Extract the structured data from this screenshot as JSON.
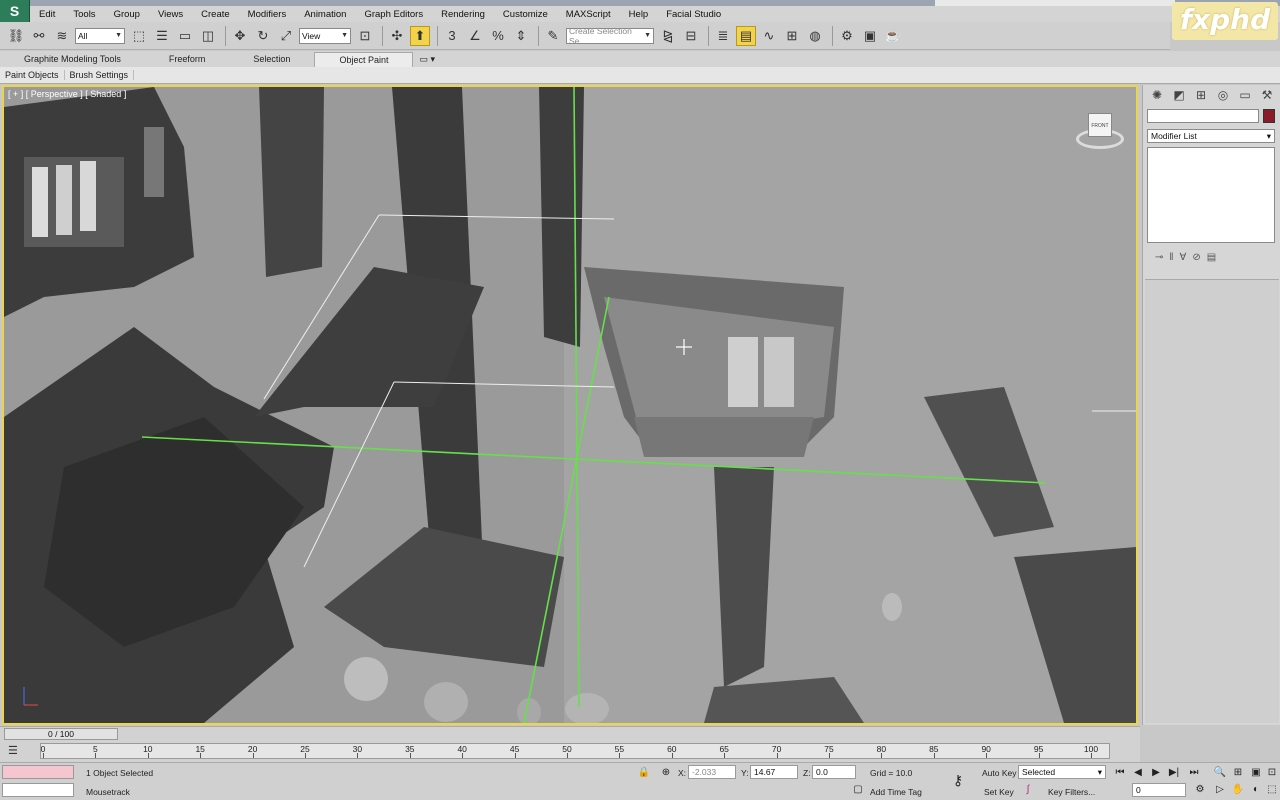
{
  "app": {
    "logo_text": "fxphd"
  },
  "menu": [
    "Edit",
    "Tools",
    "Group",
    "Views",
    "Create",
    "Modifiers",
    "Animation",
    "Graph Editors",
    "Rendering",
    "Customize",
    "MAXScript",
    "Help",
    "Facial Studio"
  ],
  "toolbar": {
    "selection_filter": "All",
    "ref_coord": "View",
    "named_selection_placeholder": "Create Selection Se",
    "snap_label": "3"
  },
  "ribbon": {
    "tabs": [
      "Graphite Modeling Tools",
      "Freeform",
      "Selection",
      "Object Paint"
    ],
    "active_tab": "Object Paint",
    "sub_tabs": [
      "Paint Objects",
      "Brush Settings"
    ]
  },
  "viewport": {
    "label": "[ + ] [ Perspective ] [ Shaded ]",
    "viewcube_face": "FRONT"
  },
  "command_panel": {
    "modifier_list": "Modifier List",
    "object_color": "#8b1a2b"
  },
  "timeline": {
    "frame_display": "0 / 100",
    "ticks": [
      0,
      5,
      10,
      15,
      20,
      25,
      30,
      35,
      40,
      45,
      50,
      55,
      60,
      65,
      70,
      75,
      80,
      85,
      90,
      95,
      100
    ]
  },
  "status": {
    "selection_text": "1 Object Selected",
    "prompt_text": "Mousetrack",
    "x_label": "X:",
    "x_value": "-2.033",
    "y_label": "Y:",
    "y_value": "14.67",
    "z_label": "Z:",
    "z_value": "0.0",
    "grid": "Grid = 10.0",
    "add_time_tag": "Add Time Tag",
    "auto_key": "Auto Key",
    "set_key": "Set Key",
    "key_mode": "Selected",
    "key_filters": "Key Filters...",
    "current_frame": "0"
  }
}
